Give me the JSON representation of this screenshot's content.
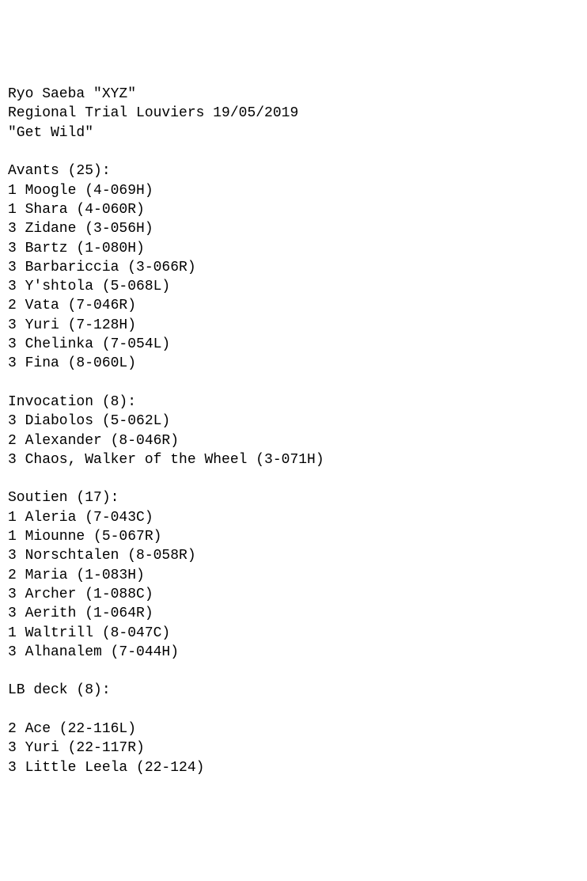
{
  "header": {
    "player": "Ryo Saeba \"XYZ\"",
    "event": "Regional Trial Louviers 19/05/2019",
    "deck_name": "\"Get Wild\""
  },
  "sections": [
    {
      "title": "Avants (25):",
      "cards": [
        {
          "qty": "1",
          "name": "Moogle",
          "code": "(4-069H)"
        },
        {
          "qty": "1",
          "name": "Shara",
          "code": "(4-060R)"
        },
        {
          "qty": "3",
          "name": "Zidane",
          "code": "(3-056H)"
        },
        {
          "qty": "3",
          "name": "Bartz",
          "code": "(1-080H)"
        },
        {
          "qty": "3",
          "name": "Barbariccia",
          "code": "(3-066R)"
        },
        {
          "qty": "3",
          "name": "Y'shtola",
          "code": "(5-068L)"
        },
        {
          "qty": "2",
          "name": "Vata",
          "code": "(7-046R)"
        },
        {
          "qty": "3",
          "name": "Yuri",
          "code": "(7-128H)"
        },
        {
          "qty": "3",
          "name": "Chelinka",
          "code": "(7-054L)"
        },
        {
          "qty": "3",
          "name": "Fina",
          "code": "(8-060L)"
        }
      ]
    },
    {
      "title": "Invocation (8):",
      "cards": [
        {
          "qty": "3",
          "name": "Diabolos",
          "code": "(5-062L)"
        },
        {
          "qty": "2",
          "name": "Alexander",
          "code": "(8-046R)"
        },
        {
          "qty": "3",
          "name": "Chaos, Walker of the Wheel",
          "code": "(3-071H)"
        }
      ]
    },
    {
      "title": "Soutien (17):",
      "cards": [
        {
          "qty": "1",
          "name": "Aleria",
          "code": "(7-043C)"
        },
        {
          "qty": "1",
          "name": "Miounne",
          "code": "(5-067R)"
        },
        {
          "qty": "3",
          "name": "Norschtalen",
          "code": "(8-058R)"
        },
        {
          "qty": "2",
          "name": "Maria",
          "code": "(1-083H)"
        },
        {
          "qty": "3",
          "name": "Archer",
          "code": "(1-088C)"
        },
        {
          "qty": "3",
          "name": "Aerith",
          "code": "(1-064R)"
        },
        {
          "qty": "1",
          "name": "Waltrill",
          "code": "(8-047C)"
        },
        {
          "qty": "3",
          "name": "Alhanalem",
          "code": "(7-044H)"
        }
      ]
    },
    {
      "title": "LB deck (8):",
      "blank_before_cards": true,
      "cards": [
        {
          "qty": "2",
          "name": "Ace",
          "code": "(22-116L)"
        },
        {
          "qty": "3",
          "name": "Yuri",
          "code": "(22-117R)"
        },
        {
          "qty": "3",
          "name": "Little Leela",
          "code": "(22-124)"
        }
      ]
    }
  ]
}
